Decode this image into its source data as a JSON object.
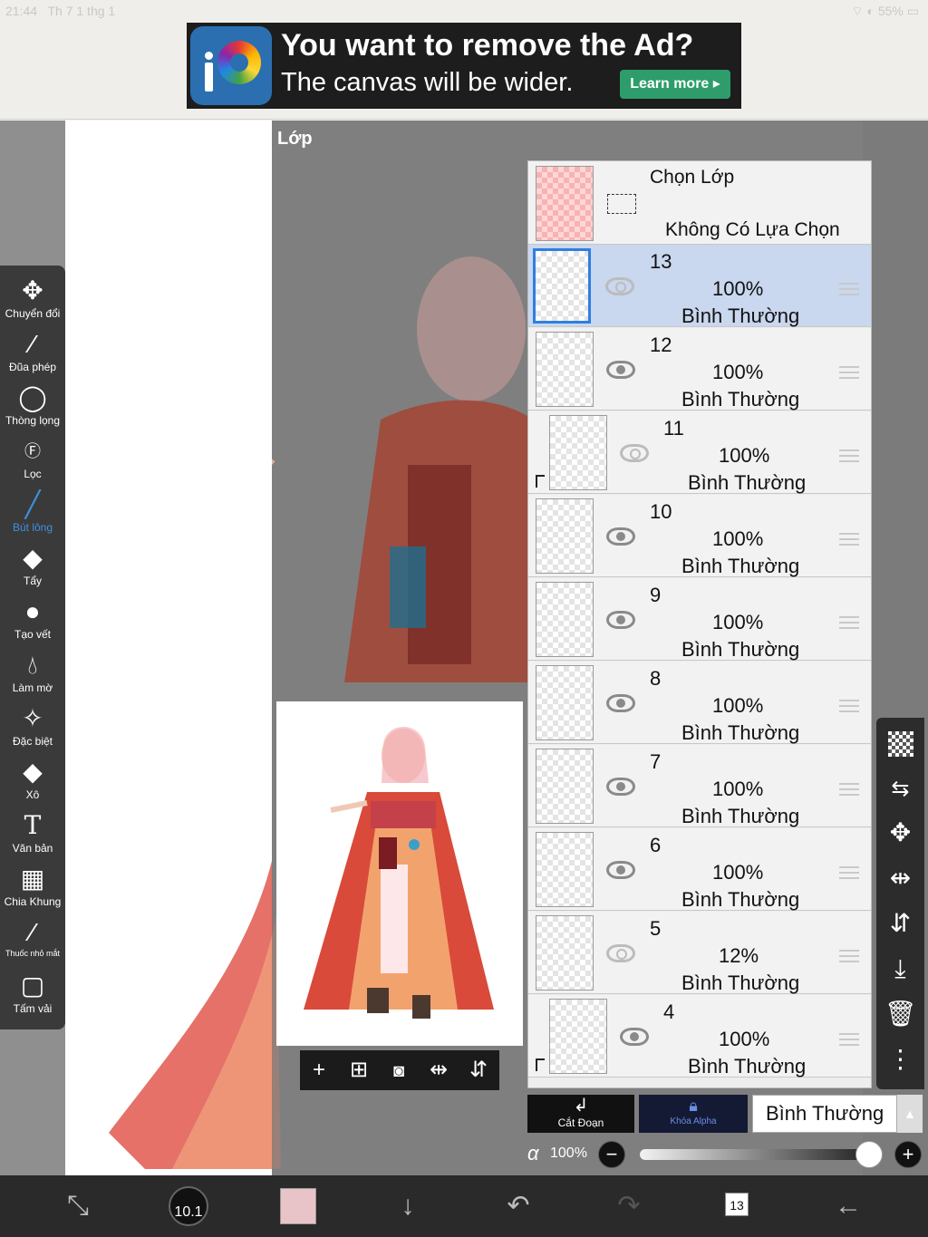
{
  "status": {
    "time": "21:44",
    "date": "Th 7 1 thg 1",
    "battery": "55%"
  },
  "ad": {
    "headline": "You want to remove the Ad?",
    "subline": "The canvas will be wider.",
    "button": "Learn more"
  },
  "tools": [
    {
      "label": "Chuyển đổi",
      "icon": "move-icon"
    },
    {
      "label": "Đũa phép",
      "icon": "magic-wand-icon"
    },
    {
      "label": "Thòng lọng",
      "icon": "lasso-icon"
    },
    {
      "label": "Lọc",
      "icon": "fx-icon"
    },
    {
      "label": "Bút lông",
      "icon": "brush-icon",
      "active": true
    },
    {
      "label": "Tẩy",
      "icon": "eraser-icon"
    },
    {
      "label": "Tạo vết",
      "icon": "smudge-icon"
    },
    {
      "label": "Làm mờ",
      "icon": "blur-drop-icon"
    },
    {
      "label": "Đặc biệt",
      "icon": "special-pen-icon"
    },
    {
      "label": "Xô",
      "icon": "bucket-icon"
    },
    {
      "label": "Văn bản",
      "icon": "text-icon"
    },
    {
      "label": "Chia Khung",
      "icon": "frame-divider-icon"
    },
    {
      "label": "Thuốc nhỏ mắt",
      "icon": "eyedropper-icon"
    },
    {
      "label": "Tấm vải",
      "icon": "canvas-icon"
    }
  ],
  "panel": {
    "title": "Lớp",
    "selection_layer": {
      "title": "Chọn Lớp",
      "subtitle": "Không Có Lựa Chọn"
    },
    "layers": [
      {
        "number": "13",
        "opacity": "100%",
        "mode": "Bình Thường",
        "selected": true,
        "visible": true,
        "clipped": false
      },
      {
        "number": "12",
        "opacity": "100%",
        "mode": "Bình Thường",
        "visible": true,
        "clipped": false
      },
      {
        "number": "11",
        "opacity": "100%",
        "mode": "Bình Thường",
        "visible": false,
        "clipped": true
      },
      {
        "number": "10",
        "opacity": "100%",
        "mode": "Bình Thường",
        "visible": true,
        "clipped": false
      },
      {
        "number": "9",
        "opacity": "100%",
        "mode": "Bình Thường",
        "visible": true,
        "clipped": false
      },
      {
        "number": "8",
        "opacity": "100%",
        "mode": "Bình Thường",
        "visible": true,
        "clipped": false
      },
      {
        "number": "7",
        "opacity": "100%",
        "mode": "Bình Thường",
        "visible": true,
        "clipped": false
      },
      {
        "number": "6",
        "opacity": "100%",
        "mode": "Bình Thường",
        "visible": true,
        "clipped": false
      },
      {
        "number": "5",
        "opacity": "12%",
        "mode": "Bình Thường",
        "visible": false,
        "clipped": false
      },
      {
        "number": "4",
        "opacity": "100%",
        "mode": "Bình Thường",
        "visible": true,
        "clipped": true
      }
    ],
    "clip_button": "Cắt Đoạn",
    "alpha_lock_button": "Khóa Alpha",
    "blend_mode": "Bình Thường",
    "alpha_symbol": "α",
    "opacity": "100%",
    "opacity_value": 1.0
  },
  "bottom": {
    "brush_size": "10.1",
    "layer_count": "13",
    "color": "#e8c4c8"
  },
  "colors": {
    "accent": "#3f8fe0",
    "toolbar": "#3a3a3a",
    "selected_row": "#c9d7ef"
  }
}
